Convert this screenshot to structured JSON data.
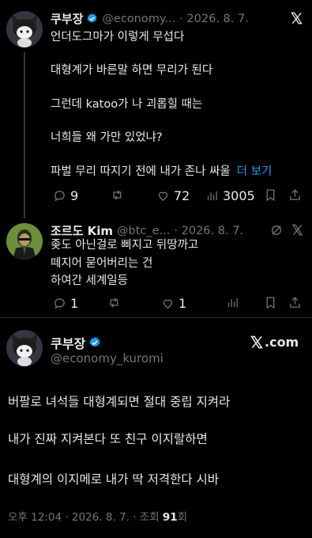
{
  "tweet1": {
    "name": "쿠부장",
    "handle": "@economy...",
    "date": "· 2026. 8. 7.",
    "lines": [
      "언더도그마가 이렇게 무섭다",
      "대형계가 바른말 하면 무리가 된다",
      "그런데 katoo가 나 괴롭힐 때는",
      "너희들 왜 가만 있었냐?",
      "파벌 무리 따지기 전에 내가 존나 싸울"
    ],
    "more_label": "더 보기",
    "replies": "9",
    "retweets": "",
    "likes": "72",
    "views": "3005"
  },
  "tweet2": {
    "name": "조르도 Kim",
    "handle": "@btc_e...",
    "date": "· 2026. 8. 7.",
    "lines": [
      "좆도 아닌걸로 삐지고 뒤땅까고",
      "떼지어 묻어버리는 건",
      "하여간 세계일등"
    ],
    "replies": "1",
    "retweets": "",
    "likes": "1"
  },
  "tweet3": {
    "name": "쿠부장",
    "handle": "@economy_kuromi",
    "source_label": ".com",
    "lines": [
      "버팔로 녀석들 대형계되면 절대 중립 지켜라",
      "내가 진짜 지켜본다 또 친구 이지랄하면",
      "대형계의 이지메로 내가 딱 저격한다 시바"
    ],
    "footer_prefix": "오후 12:04 · 2026. 8. 7. · 조회 ",
    "footer_views": "91",
    "footer_suffix": "회"
  },
  "colors": {
    "background": "#000000",
    "text": "#e7e9ea",
    "muted": "#71767b",
    "link": "#1d9bf0",
    "verified": "#1d9bf0"
  },
  "icons": [
    "x-logo-icon",
    "verified-badge-icon",
    "reply-icon",
    "retweet-icon",
    "like-icon",
    "views-icon",
    "bookmark-icon",
    "share-icon",
    "grok-icon"
  ]
}
